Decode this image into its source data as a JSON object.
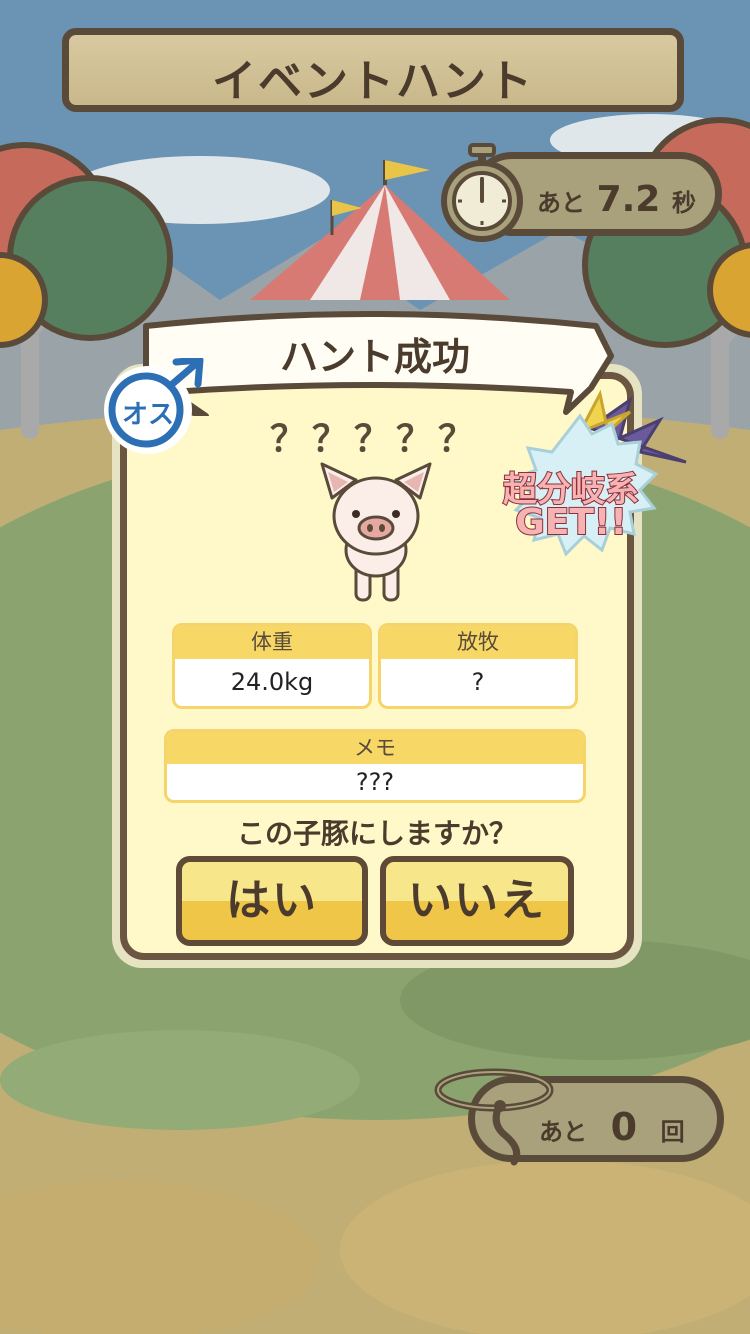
{
  "title": "イベントハント",
  "timer": {
    "prefix": "あと",
    "value": "7.2",
    "unit": "秒"
  },
  "result": {
    "title": "ハント成功",
    "gender_label": "オス",
    "pig_name": "？？？？？",
    "badge": {
      "line1": "超分岐系",
      "line2": "GET!!"
    },
    "stats": {
      "weight": {
        "label": "体重",
        "value": "24.0kg"
      },
      "grazing": {
        "label": "放牧",
        "value": "?"
      },
      "memo": {
        "label": "メモ",
        "value": "???"
      }
    },
    "question": "この子豚にしますか？",
    "buttons": {
      "yes": "はい",
      "no": "いいえ"
    }
  },
  "attempts": {
    "prefix": "あと",
    "value": "0",
    "unit": "回"
  },
  "colors": {
    "border": "#5a4a3a",
    "panel": "#fff8c8",
    "button": "#efc647",
    "accent_blue": "#2c6fb5"
  }
}
